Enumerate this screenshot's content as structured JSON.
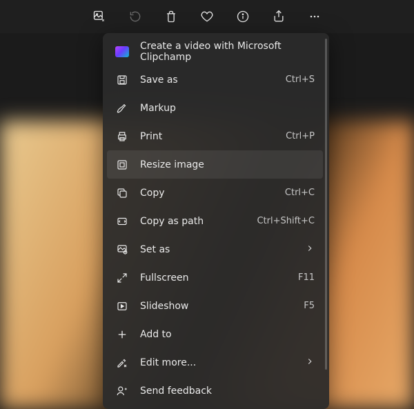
{
  "toolbar": {
    "items": [
      {
        "name": "edit-image-icon"
      },
      {
        "name": "rotate-icon"
      },
      {
        "name": "delete-icon"
      },
      {
        "name": "favorite-icon"
      },
      {
        "name": "info-icon"
      },
      {
        "name": "share-icon"
      },
      {
        "name": "more-icon"
      }
    ]
  },
  "menu": {
    "items": [
      {
        "icon": "clipchamp-icon",
        "label": "Create a video with Microsoft Clipchamp",
        "accel": "",
        "sub": false
      },
      {
        "icon": "save-icon",
        "label": "Save as",
        "accel": "Ctrl+S",
        "sub": false
      },
      {
        "icon": "markup-icon",
        "label": "Markup",
        "accel": "",
        "sub": false
      },
      {
        "icon": "print-icon",
        "label": "Print",
        "accel": "Ctrl+P",
        "sub": false
      },
      {
        "icon": "resize-icon",
        "label": "Resize image",
        "accel": "",
        "sub": false,
        "highlight": true
      },
      {
        "icon": "copy-icon",
        "label": "Copy",
        "accel": "Ctrl+C",
        "sub": false
      },
      {
        "icon": "copy-path-icon",
        "label": "Copy as path",
        "accel": "Ctrl+Shift+C",
        "sub": false
      },
      {
        "icon": "set-as-icon",
        "label": "Set as",
        "accel": "",
        "sub": true
      },
      {
        "icon": "fullscreen-icon",
        "label": "Fullscreen",
        "accel": "F11",
        "sub": false
      },
      {
        "icon": "slideshow-icon",
        "label": "Slideshow",
        "accel": "F5",
        "sub": false
      },
      {
        "icon": "add-icon",
        "label": "Add to",
        "accel": "",
        "sub": false
      },
      {
        "icon": "edit-more-icon",
        "label": "Edit more...",
        "accel": "",
        "sub": true
      },
      {
        "icon": "feedback-icon",
        "label": "Send feedback",
        "accel": "",
        "sub": false
      }
    ]
  }
}
